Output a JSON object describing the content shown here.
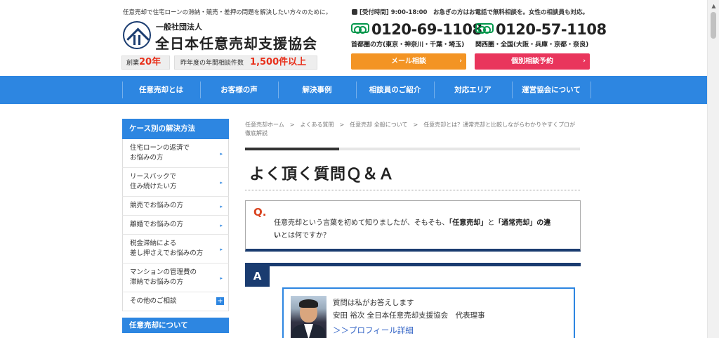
{
  "header": {
    "tagline": "任意売却で住宅ローンの滞納・競売・差押の問題を解決したい方々のために。",
    "org_type": "一般社団法人",
    "org_name": "全日本任意売却支援協会",
    "founded_label": "創業",
    "founded_value": "20年",
    "count_label": "昨年度の年間相談件数",
    "count_value": "1,500件以上",
    "hours": "[受付時間] 9:00-18:00　お急ぎの方はお電話で無料相談を。女性の相談員も対応。",
    "tel1": "0120-69-1108",
    "area1": "首都圏の方(東京・神奈川・千葉・埼玉)",
    "tel2": "0120-57-1108",
    "area2": "関西圏・全国(大阪・兵庫・京都・奈良)",
    "mail_button": "メール相談",
    "booking_button": "個別相談予約"
  },
  "nav": {
    "items": [
      "任意売却とは",
      "お客様の声",
      "解決事例",
      "相談員のご紹介",
      "対応エリア",
      "運営協会について"
    ]
  },
  "sidebar": {
    "heading": "ケース別の解決方法",
    "items": [
      {
        "line1": "住宅ローンの返済で",
        "line2": "お悩みの方"
      },
      {
        "line1": "リースバックで",
        "line2": "住み続けたい方"
      },
      {
        "line1": "競売でお悩みの方",
        "line2": ""
      },
      {
        "line1": "離婚でお悩みの方",
        "line2": ""
      },
      {
        "line1": "税金滞納による",
        "line2": "差し押さえでお悩みの方"
      },
      {
        "line1": "マンションの管理費の",
        "line2": "滞納でお悩みの方"
      },
      {
        "line1": "その他のご相談",
        "line2": ""
      }
    ],
    "heading2": "任意売却について"
  },
  "breadcrumb": {
    "items": [
      "任意売却ホーム",
      "よくある質問",
      "任意売却 全般について",
      "任意売却とは？通常売却と比較しながらわかりやすくプロが徹底解説"
    ]
  },
  "main": {
    "title": "よく頂く質問Ｑ＆Ａ",
    "q_mark": "Q.",
    "q_text_1": "任意売却という言葉を初めて知りましたが、そもそも、",
    "q_bold_1": "「任意売却」",
    "q_text_2": "と",
    "q_bold_2": "「通常売却」の違い",
    "q_text_3": "とは何ですか？",
    "a_mark": "A",
    "answer_intro": "質問は私がお答えします",
    "answer_name": "安田 裕次 全日本任意売却支援協会　代表理事",
    "profile_link": "＞＞プロフィール詳細"
  }
}
